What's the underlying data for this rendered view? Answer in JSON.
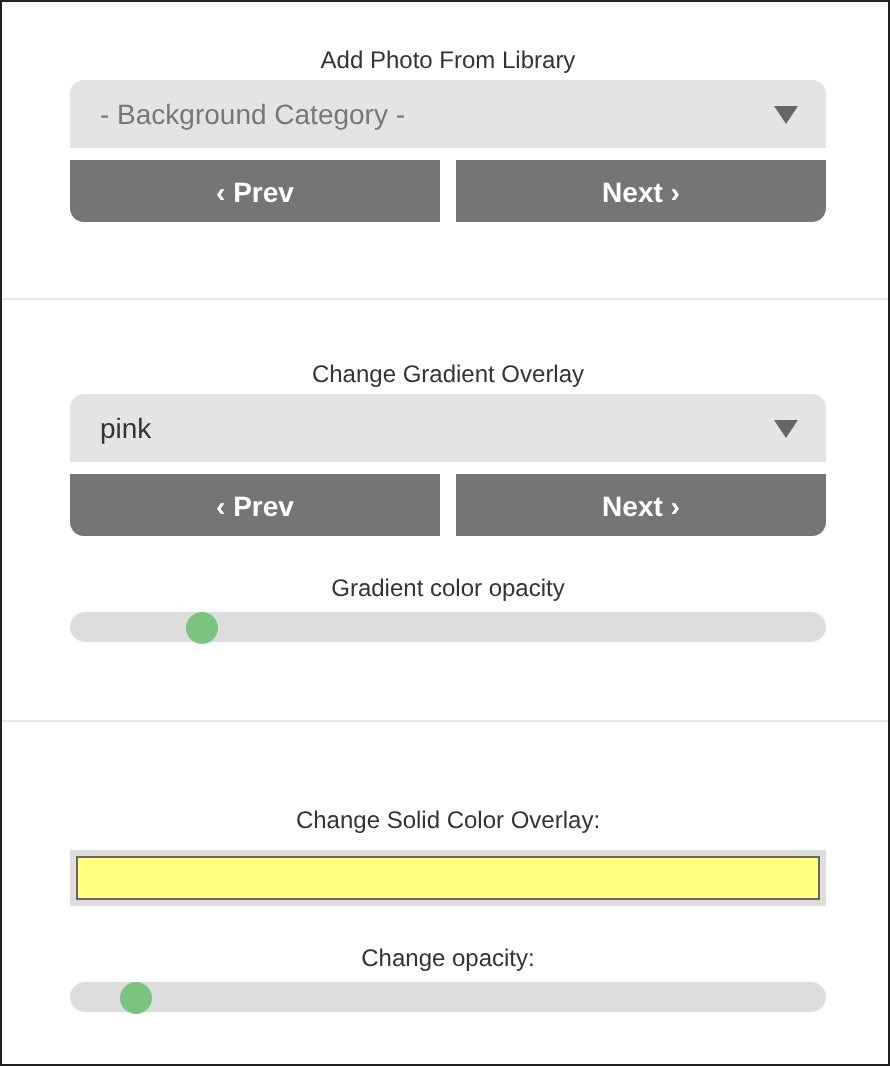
{
  "sections": [
    {
      "label": "Add Photo From Library",
      "select": {
        "value": "- Background Category -",
        "placeholder_style": true
      },
      "buttons": [
        "‹ Prev",
        "Next ›"
      ]
    },
    {
      "label": "Change Gradient Overlay",
      "select": {
        "value": "pink",
        "placeholder_style": false
      },
      "buttons": [
        "‹ Prev",
        "Next ›"
      ],
      "slider": {
        "label": "Gradient color opacity",
        "level": 0.16
      }
    },
    {
      "label": "Change Solid Color Overlay:",
      "swatch": {
        "color": "#ffff80"
      },
      "slider": {
        "label": "Change opacity:",
        "level": 0.07
      }
    }
  ]
}
